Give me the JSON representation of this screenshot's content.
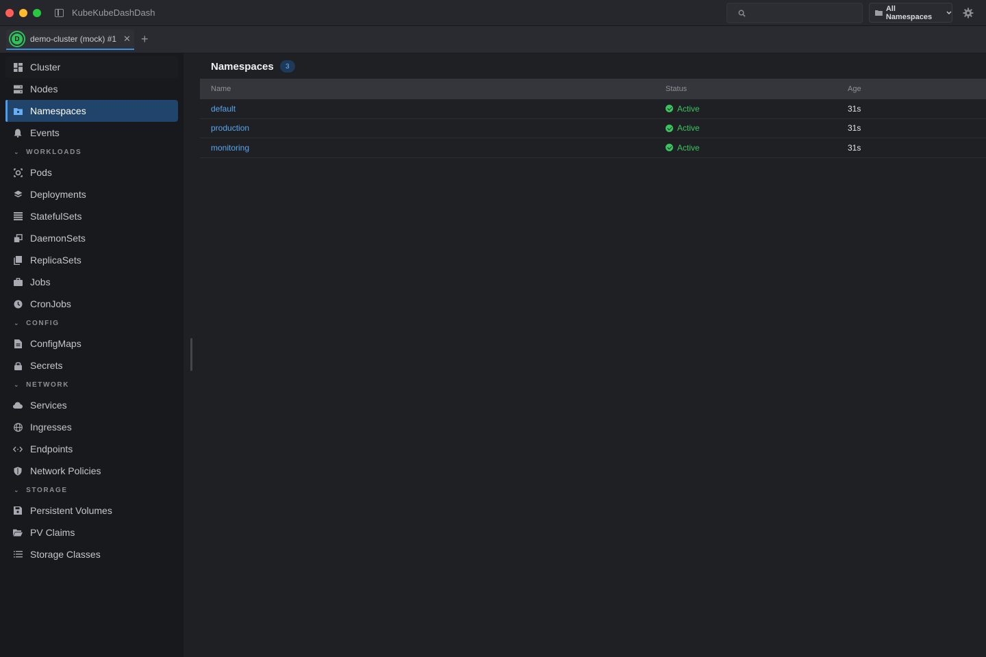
{
  "window": {
    "title": "KubeKubeDashDash"
  },
  "search": {
    "value": "",
    "placeholder": ""
  },
  "namespace_selector": {
    "label": "All Namespaces"
  },
  "tabs": [
    {
      "label": "demo-cluster (mock) #1",
      "avatar": "D"
    }
  ],
  "sidebar": {
    "top": [
      {
        "label": "Cluster",
        "icon": "dashboard-icon"
      },
      {
        "label": "Nodes",
        "icon": "server-icon"
      },
      {
        "label": "Namespaces",
        "icon": "folder-icon",
        "active": true
      },
      {
        "label": "Events",
        "icon": "bell-icon"
      }
    ],
    "sections": [
      {
        "title": "WORKLOADS",
        "items": [
          {
            "label": "Pods",
            "icon": "pod-icon"
          },
          {
            "label": "Deployments",
            "icon": "layers-icon"
          },
          {
            "label": "StatefulSets",
            "icon": "list-icon"
          },
          {
            "label": "DaemonSets",
            "icon": "copy-icon"
          },
          {
            "label": "ReplicaSets",
            "icon": "replica-icon"
          },
          {
            "label": "Jobs",
            "icon": "briefcase-icon"
          },
          {
            "label": "CronJobs",
            "icon": "clock-icon"
          }
        ]
      },
      {
        "title": "CONFIG",
        "items": [
          {
            "label": "ConfigMaps",
            "icon": "file-icon"
          },
          {
            "label": "Secrets",
            "icon": "lock-icon"
          }
        ]
      },
      {
        "title": "NETWORK",
        "items": [
          {
            "label": "Services",
            "icon": "cloud-icon"
          },
          {
            "label": "Ingresses",
            "icon": "globe-icon"
          },
          {
            "label": "Endpoints",
            "icon": "code-icon"
          },
          {
            "label": "Network Policies",
            "icon": "shield-icon"
          }
        ]
      },
      {
        "title": "STORAGE",
        "items": [
          {
            "label": "Persistent Volumes",
            "icon": "save-icon"
          },
          {
            "label": "PV Claims",
            "icon": "folder-open-icon"
          },
          {
            "label": "Storage Classes",
            "icon": "list-lines-icon"
          }
        ]
      }
    ]
  },
  "main": {
    "title": "Namespaces",
    "count": "3",
    "columns": {
      "name": "Name",
      "status": "Status",
      "age": "Age"
    },
    "rows": [
      {
        "name": "default",
        "status": "Active",
        "age": "31s"
      },
      {
        "name": "production",
        "status": "Active",
        "age": "31s"
      },
      {
        "name": "monitoring",
        "status": "Active",
        "age": "31s"
      }
    ]
  },
  "colors": {
    "accent": "#4b9ef0",
    "active_bg": "#21446b",
    "status_active": "#38c55d",
    "link": "#58a6f0"
  }
}
